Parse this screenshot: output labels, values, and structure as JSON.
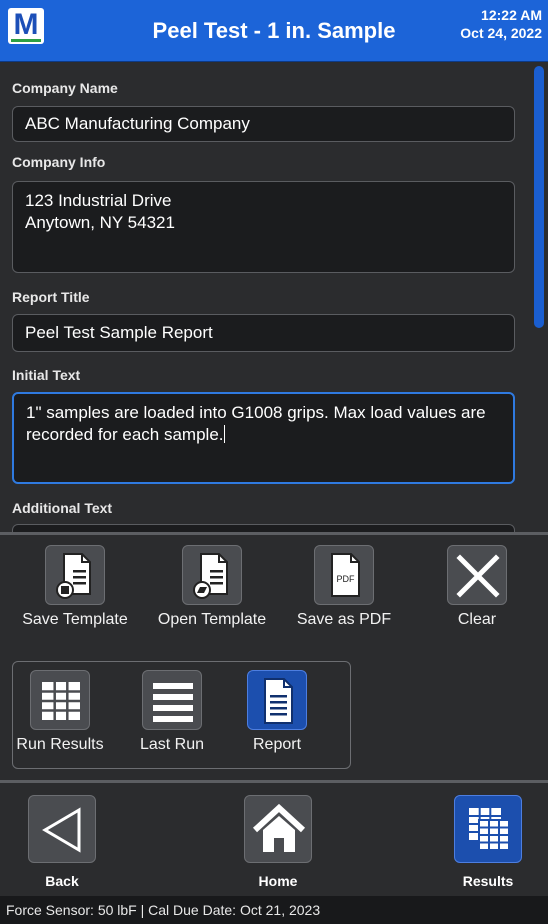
{
  "header": {
    "logo": "M",
    "title": "Peel Test - 1 in. Sample",
    "time": "12:22 AM",
    "date": "Oct 24, 2022"
  },
  "form": {
    "company_name": {
      "label": "Company Name",
      "value": "ABC Manufacturing Company"
    },
    "company_info": {
      "label": "Company Info",
      "value": "123 Industrial Drive\nAnytown, NY 54321"
    },
    "report_title": {
      "label": "Report Title",
      "value": "Peel Test Sample Report"
    },
    "initial_text": {
      "label": "Initial Text",
      "value": "1\" samples are loaded into G1008 grips. Max load values are recorded for each sample."
    },
    "additional_text": {
      "label": "Additional Text"
    }
  },
  "toolbar": {
    "save_template": "Save Template",
    "open_template": "Open Template",
    "save_pdf": "Save as PDF",
    "pdf_icon_text": "PDF",
    "clear": "Clear",
    "run_results": "Run Results",
    "last_run": "Last Run",
    "report": "Report"
  },
  "nav": {
    "back": "Back",
    "home": "Home",
    "results": "Results"
  },
  "status": {
    "text": "Force Sensor: 50 lbF  |  Cal Due Date: Oct 21, 2023"
  },
  "colors": {
    "accent": "#1c64d8",
    "selected": "#1c4fae"
  }
}
